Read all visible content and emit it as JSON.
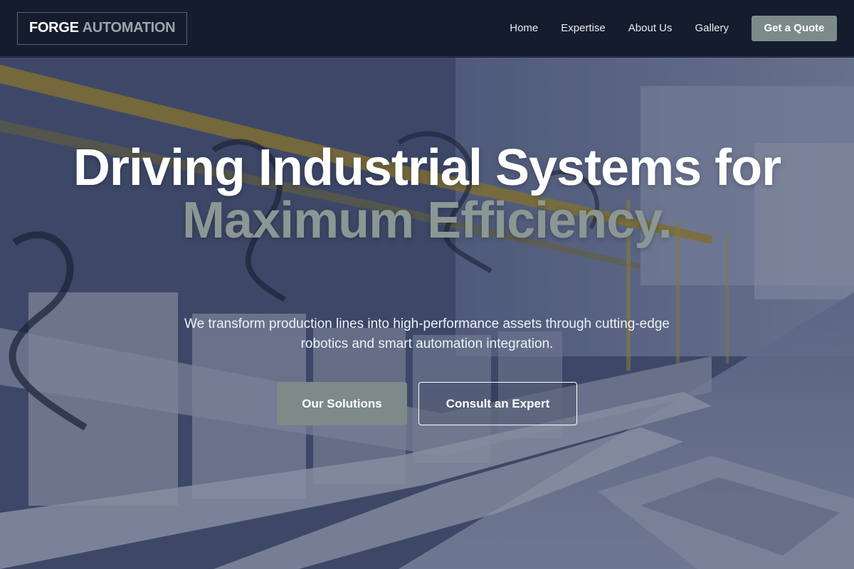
{
  "header": {
    "logo_strong": "FORGE",
    "logo_soft": "AUTOMATION",
    "nav": [
      "Home",
      "Expertise",
      "About Us",
      "Gallery"
    ],
    "cta": "Get a Quote"
  },
  "hero": {
    "headline_part1": "Driving Industrial Systems for ",
    "headline_accent": "Maximum Efficiency.",
    "subtext": "We transform production lines into high-performance assets through cutting-edge robotics and smart automation integration.",
    "primary_cta": "Our Solutions",
    "secondary_cta": "Consult an Expert"
  },
  "colors": {
    "header_bg": "#141c2e",
    "accent": "#8a9794",
    "button_bg": "#7d8a88",
    "overlay": "#161e3c"
  }
}
